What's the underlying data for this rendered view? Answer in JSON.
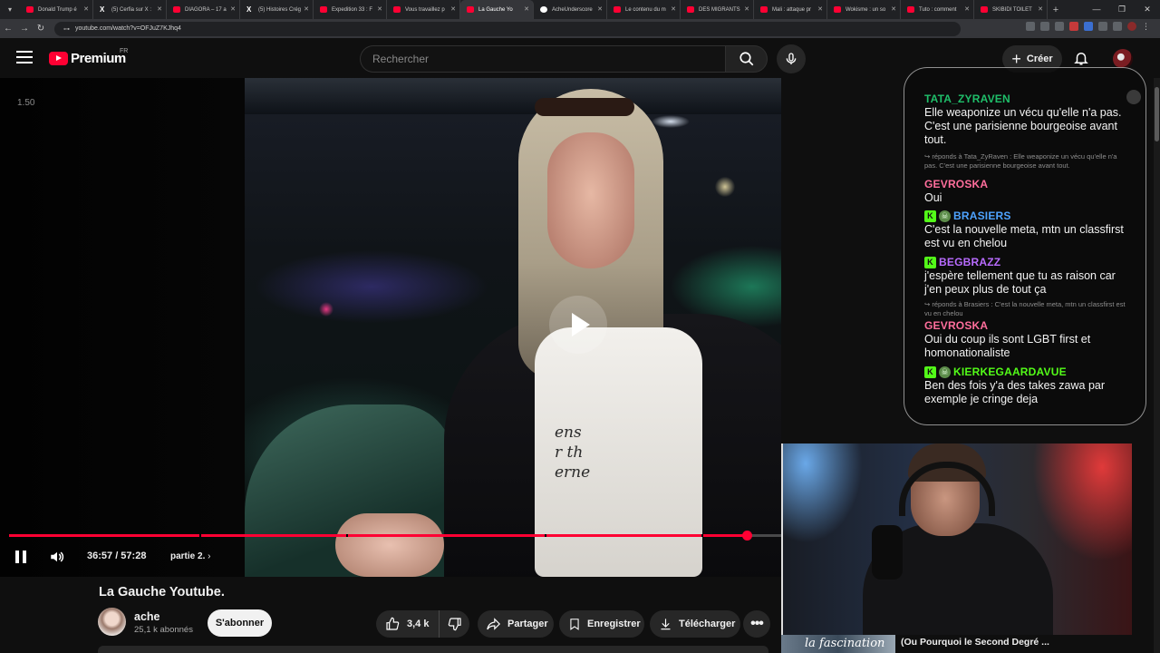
{
  "browser": {
    "tabs": [
      {
        "label": "Donald Trump é",
        "favicon": "youtube-favicon"
      },
      {
        "label": "(5) Cerfia sur X :",
        "favicon": "x-favicon"
      },
      {
        "label": "DIAGORA – 17 a",
        "favicon": "youtube-favicon"
      },
      {
        "label": "(5) Histoires Crég",
        "favicon": "x-favicon"
      },
      {
        "label": "Expedition 33 : F",
        "favicon": "youtube-favicon"
      },
      {
        "label": "Vous travaillez p",
        "favicon": "youtube-favicon"
      },
      {
        "label": "La Gauche Yo",
        "favicon": "youtube-favicon",
        "active": true
      },
      {
        "label": "AcheUnderscore",
        "favicon": "github-favicon"
      },
      {
        "label": "Le contenu du m",
        "favicon": "youtube-favicon"
      },
      {
        "label": "DES MIGRANTS",
        "favicon": "youtube-favicon"
      },
      {
        "label": "Mali : attaque pr",
        "favicon": "youtube-favicon"
      },
      {
        "label": "Wokisme : un so",
        "favicon": "youtube-favicon"
      },
      {
        "label": "Tuto : comment",
        "favicon": "youtube-favicon"
      },
      {
        "label": "SKIBIDI TOILET",
        "favicon": "youtube-favicon"
      }
    ],
    "url": "youtube.com/watch?v=OFJuZ7KJhq4"
  },
  "header": {
    "brand": "Premium",
    "country_code": "FR",
    "search_placeholder": "Rechercher",
    "create_label": "Créer"
  },
  "player": {
    "speed_overlay": "1.50",
    "time_current": "36:57",
    "time_total": "57:28",
    "time_display": "36:57 / 57:28",
    "chapter_label": "partie 2.",
    "progress": 0.9555,
    "chapter_marks": [
      0.247,
      0.437,
      0.694,
      0.897
    ],
    "accent": "#ff0033",
    "shirt_text": [
      "ens",
      "r th",
      "erne"
    ]
  },
  "chat": {
    "messages": [
      {
        "user": "TATA_ZYRAVEN",
        "color": "#1fbf6a",
        "badges": [],
        "text": "Elle weaponize un vécu qu'elle n'a pas. C'est une parisienne bourgeoise avant tout."
      },
      {
        "reply": "↪ réponds à Tata_ZyRaven : Elle weaponize un vécu qu'elle n'a pas. C'est une parisienne bourgeoise avant tout."
      },
      {
        "user": "GEVROSKA",
        "color": "#ff6e9c",
        "badges": [],
        "text": "Oui"
      },
      {
        "user": "BRASIERS",
        "color": "#4ea3ff",
        "badges": [
          "K",
          "☠"
        ],
        "text": "C'est la nouvelle meta, mtn un classfirst est vu en chelou"
      },
      {
        "user": "BEGBRAZZ",
        "color": "#b86bff",
        "badges": [
          "K"
        ],
        "text": "j'espère tellement que tu as raison car j'en peux plus de tout ça"
      },
      {
        "reply": "↪ réponds à Brasiers : C'est la nouvelle meta, mtn un classfirst est vu en chelou"
      },
      {
        "user": "GEVROSKA",
        "color": "#ff6e9c",
        "badges": [],
        "text": "Oui du coup ils sont LGBT first et homonationaliste"
      },
      {
        "user": "KIERKEGAARDAVUE",
        "color": "#53fc18",
        "badges": [
          "K",
          "☠"
        ],
        "text": "Ben des fois y'a des takes zawa par exemple je cringe deja"
      }
    ]
  },
  "video": {
    "title": "La Gauche Youtube.",
    "channel_name": "ache",
    "subscribers": "25,1 k abonnés",
    "subscribe_label": "S'abonner",
    "like_count": "3,4 k",
    "share_label": "Partager",
    "save_label": "Enregistrer",
    "download_label": "Télécharger"
  },
  "webcam_caption": {
    "thumb_text": "la fascination",
    "title": "(Ou Pourquoi le Second Degré ..."
  }
}
